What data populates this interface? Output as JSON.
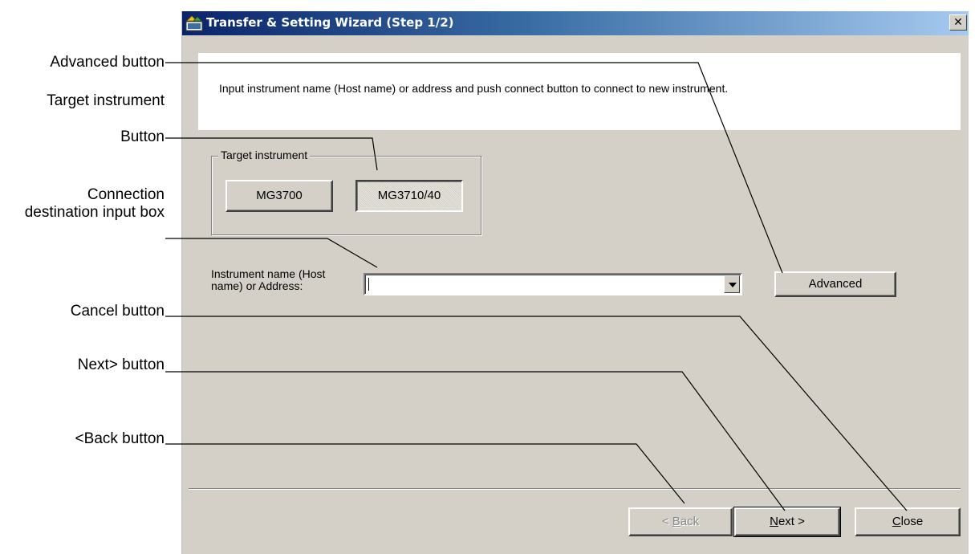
{
  "window": {
    "title": "Transfer & Setting Wizard (Step 1/2)",
    "close_glyph": "✕"
  },
  "instruction": "Input instrument name (Host name) or address and push connect button to connect to new instrument.",
  "target_group": {
    "legend": "Target instrument",
    "buttons": [
      {
        "label": "MG3700",
        "state": "normal"
      },
      {
        "label": "MG3710/40",
        "state": "pressed"
      }
    ]
  },
  "connection": {
    "label": "Instrument name (Host name) or Address:",
    "value": "",
    "dropdown_icon": "chevron-down-icon"
  },
  "advanced_button": {
    "label": "Advanced"
  },
  "nav_buttons": {
    "back": {
      "prefix": "< ",
      "mnemonic": "B",
      "rest": "ack",
      "enabled": false
    },
    "next": {
      "prefix": "",
      "mnemonic": "N",
      "rest": "ext >",
      "enabled": true
    },
    "close": {
      "prefix": "",
      "mnemonic": "C",
      "rest": "lose",
      "enabled": true
    }
  },
  "callouts": {
    "advanced": "Advanced  button",
    "target": "Target  instrument",
    "button": "Button",
    "connection_dest": "Connection destination input  box",
    "cancel": "Cancel  button",
    "next": "Next>  button",
    "back": "<Back  button"
  },
  "colors": {
    "titlebar_start": "#0a246a",
    "titlebar_end": "#a6caf0",
    "dialog_face": "#d4d0c8",
    "panel": "#ffffff"
  }
}
